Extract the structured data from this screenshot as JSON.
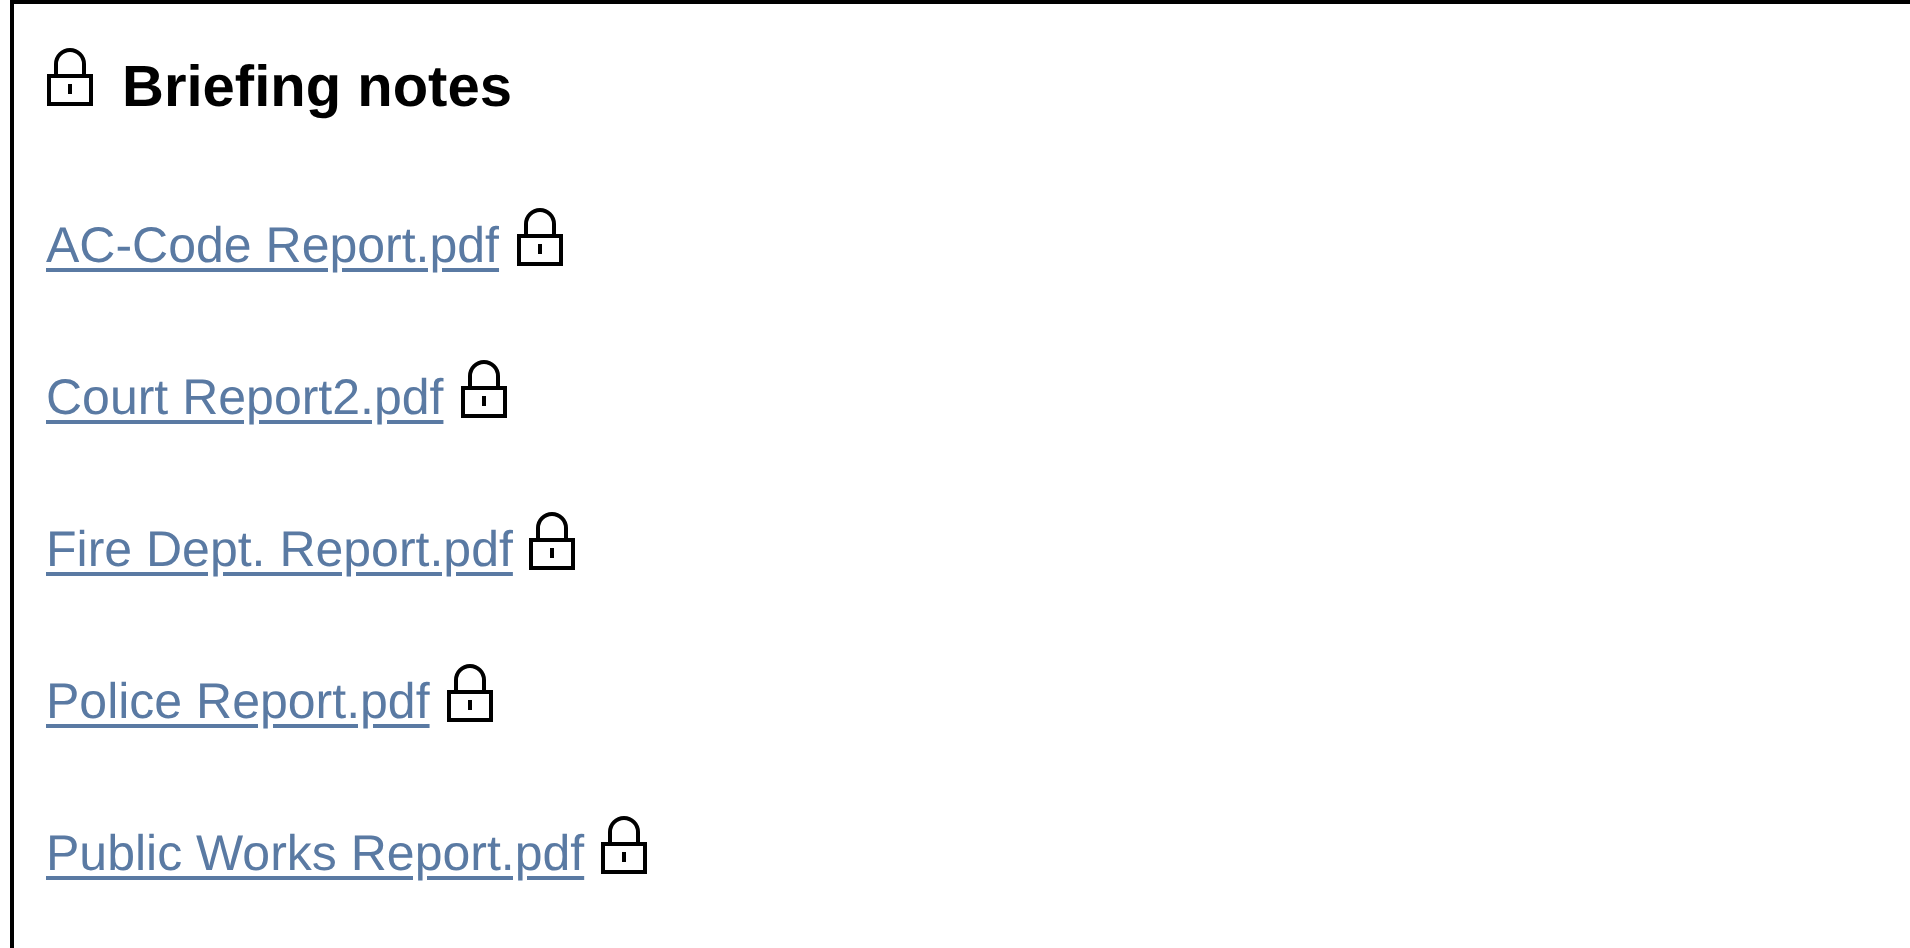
{
  "panel": {
    "title": "Briefing notes",
    "title_locked": true,
    "files": [
      {
        "name": "AC-Code Report.pdf",
        "locked": true
      },
      {
        "name": "Court Report2.pdf",
        "locked": true
      },
      {
        "name": "Fire Dept. Report.pdf",
        "locked": true
      },
      {
        "name": "Police Report.pdf",
        "locked": true
      },
      {
        "name": "Public Works Report.pdf",
        "locked": true
      }
    ]
  }
}
